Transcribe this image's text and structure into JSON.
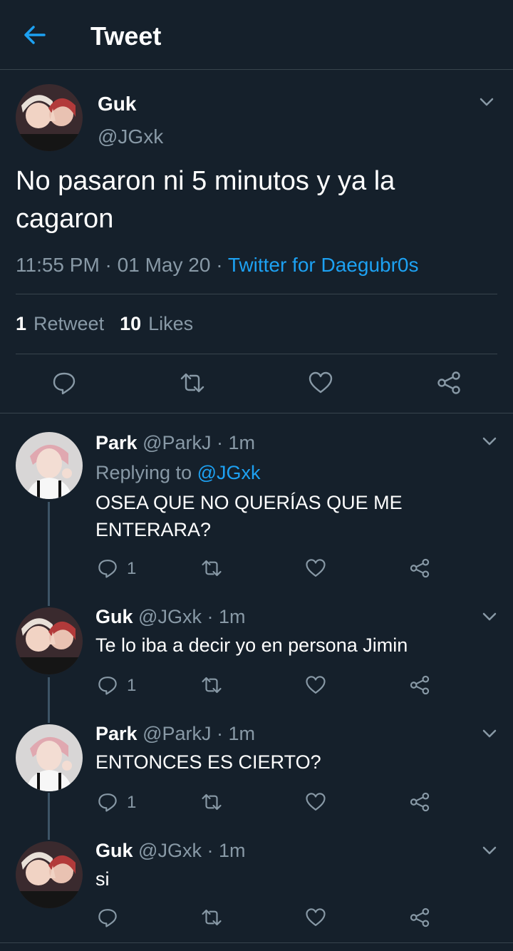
{
  "header": {
    "title": "Tweet",
    "back_icon": "arrow-left-icon"
  },
  "colors": {
    "background": "#15202b",
    "accent": "#1da1f2",
    "secondary_text": "#8899a6",
    "border": "#38444d"
  },
  "main_tweet": {
    "name": "Guk",
    "handle": "@JGxk",
    "text": "No pasaron ni 5 minutos y ya la cagaron",
    "time": "11:55 PM",
    "sep1": " · ",
    "date": "01 May 20",
    "sep2": " · ",
    "source": "Twitter for Daegubr0s",
    "retweets_count": "1",
    "retweets_label": "Retweet",
    "likes_count": "10",
    "likes_label": "Likes"
  },
  "replies": [
    {
      "name": "Park",
      "handle": "@ParkJ",
      "time": " · 1m",
      "replying_label": "Replying to ",
      "replying_to": "@JGxk",
      "text": "OSEA QUE NO QUERÍAS QUE ME ENTERARA?",
      "reply_count": "1"
    },
    {
      "name": "Guk",
      "handle": "@JGxk",
      "time": " · 1m",
      "text": "Te lo iba a decir yo en persona Jimin",
      "reply_count": "1"
    },
    {
      "name": "Park",
      "handle": "@ParkJ",
      "time": " · 1m",
      "text": "ENTONCES ES CIERTO?",
      "reply_count": "1"
    },
    {
      "name": "Guk",
      "handle": "@JGxk",
      "time": " · 1m",
      "text": "si",
      "reply_count": ""
    }
  ]
}
